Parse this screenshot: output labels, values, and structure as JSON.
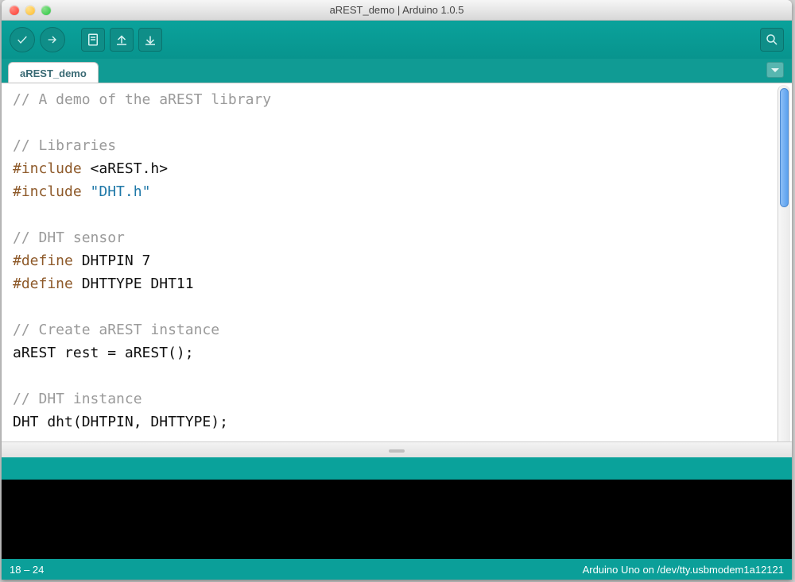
{
  "window": {
    "title": "aREST_demo | Arduino 1.0.5"
  },
  "tab": {
    "label": "aREST_demo"
  },
  "status": {
    "left": "18 – 24",
    "right": "Arduino Uno on /dev/tty.usbmodem1a12121"
  },
  "code": {
    "l1_comment": "// A demo of the aREST library",
    "l2_blank": "",
    "l3_comment": "// Libraries",
    "l4a_kw": "#include ",
    "l4b_str": "<aREST.h>",
    "l5a_kw": "#include ",
    "l5b_str": "\"DHT.h\"",
    "l6_blank": "",
    "l7_comment": "// DHT sensor",
    "l8a_kw": "#define",
    "l8b_rest": " DHTPIN 7",
    "l9a_kw": "#define",
    "l9b_rest": " DHTTYPE DHT11",
    "l10_blank": "",
    "l11_comment": "// Create aREST instance",
    "l12_code": "aREST rest = aREST();",
    "l13_blank": "",
    "l14_comment": "// DHT instance",
    "l15_code": "DHT dht(DHTPIN, DHTTYPE);"
  }
}
